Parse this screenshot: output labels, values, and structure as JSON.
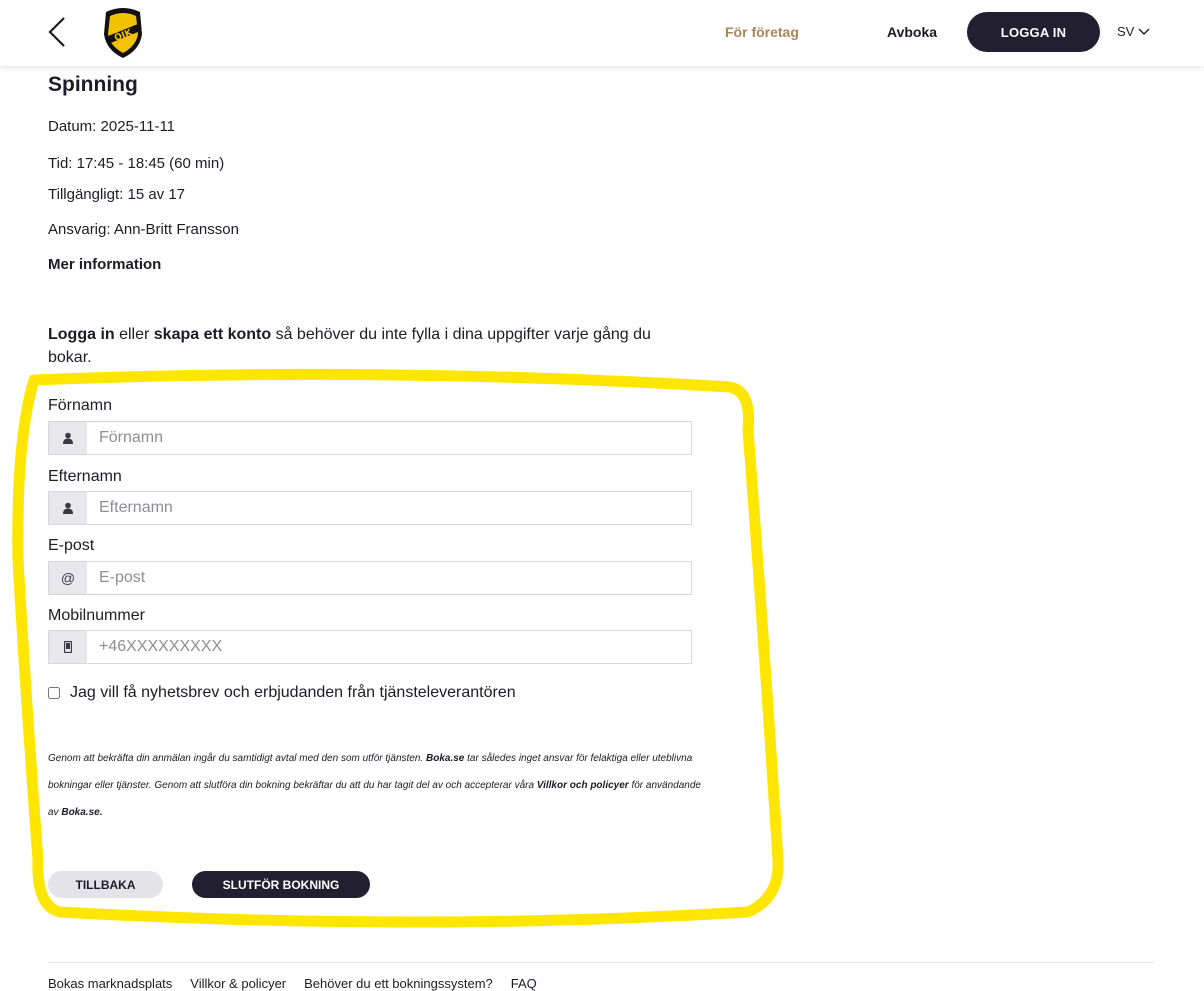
{
  "header": {
    "nav_business": "För företag",
    "nav_cancel": "Avboka",
    "login_label": "LOGGA IN",
    "language": "SV",
    "logo_text": "ÖIK"
  },
  "event": {
    "title": "Spinning",
    "date": "Datum: 2025-11-11",
    "time": "Tid: 17:45 - 18:45 (60 min)",
    "available": "Tillgängligt: 15 av 17",
    "responsible": "Ansvarig: Ann-Britt Fransson",
    "more_info": "Mer information"
  },
  "login_hint": {
    "login": "Logga in",
    "or": " eller ",
    "create": "skapa ett konto",
    "rest": " så behöver du inte fylla i dina uppgifter varje gång du bokar."
  },
  "form": {
    "first_name_label": "Förnamn",
    "first_name_placeholder": "Förnamn",
    "first_name_value": "",
    "last_name_label": "Efternamn",
    "last_name_placeholder": "Efternamn",
    "last_name_value": "",
    "email_label": "E-post",
    "email_placeholder": "E-post",
    "email_value": "",
    "email_addon": "@",
    "mobile_label": "Mobilnummer",
    "mobile_placeholder": "+46XXXXXXXXX",
    "mobile_value": "",
    "newsletter_label": "Jag vill få nyhetsbrev och erbjudanden från tjänsteleverantören",
    "newsletter_checked": false
  },
  "terms": {
    "t1": "Genom att bekräfta din anmälan ingår du samtidigt avtal med den som utför tjänsten. ",
    "brand1": "Boka.se",
    "t2": " tar således inget ansvar för felaktiga eller uteblivna bokningar eller tjänster. Genom att slutföra din bokning bekräftar du att du har tagit del av och accepterar våra ",
    "policy_link": "Villkor och policyer",
    "t3": " för användande av ",
    "brand2": "Boka.se."
  },
  "actions": {
    "back_label": "TILLBAKA",
    "finish_label": "SLUTFÖR BOKNING"
  },
  "footer": {
    "links": [
      "Bokas marknadsplats",
      "Villkor & policyer",
      "Behöver du ett bokningssystem?",
      "FAQ"
    ]
  },
  "colors": {
    "accent_dark": "#221f30",
    "business_link": "#a8865c",
    "highlight": "#ffe600",
    "logo_yellow": "#f2c200"
  },
  "icons": [
    "chevron-left-icon",
    "user-icon",
    "at-icon",
    "mobile-icon",
    "chevron-down-icon"
  ]
}
